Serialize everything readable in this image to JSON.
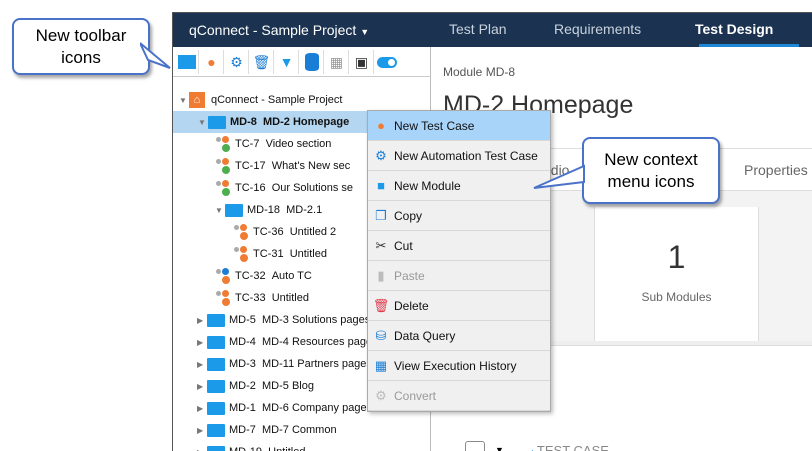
{
  "header": {
    "project": "qConnect - Sample Project",
    "tabs": [
      {
        "label": "Test Plan"
      },
      {
        "label": "Requirements"
      },
      {
        "label": "Test Design",
        "active": true
      }
    ]
  },
  "toolbar": {
    "icons": [
      "new-module-icon",
      "new-test-case-icon",
      "new-automation-test-case-icon",
      "delete-icon",
      "filter-icon",
      "data-query-icon",
      "export-excel-icon",
      "report-icon",
      "toggle-icon"
    ]
  },
  "tree": {
    "root": "qConnect - Sample Project",
    "items": [
      {
        "id": "MD-8",
        "label": "MD-2 Homepage",
        "type": "module",
        "selected": true
      },
      {
        "id": "TC-7",
        "label": "Video section",
        "type": "tc"
      },
      {
        "id": "TC-17",
        "label": "What's New sec",
        "type": "tc"
      },
      {
        "id": "TC-16",
        "label": "Our Solutions se",
        "type": "tc"
      },
      {
        "id": "MD-18",
        "label": "MD-2.1",
        "type": "module"
      },
      {
        "id": "TC-36",
        "label": "Untitled 2",
        "type": "tc2"
      },
      {
        "id": "TC-31",
        "label": "Untitled",
        "type": "tc2"
      },
      {
        "id": "TC-32",
        "label": "Auto TC",
        "type": "auto"
      },
      {
        "id": "TC-33",
        "label": "Untitled",
        "type": "tc2"
      },
      {
        "id": "MD-5",
        "label": "MD-3 Solutions pages",
        "type": "module"
      },
      {
        "id": "MD-4",
        "label": "MD-4 Resources page",
        "type": "module"
      },
      {
        "id": "MD-3",
        "label": "MD-11 Partners pages",
        "type": "module"
      },
      {
        "id": "MD-2",
        "label": "MD-5 Blog",
        "type": "module"
      },
      {
        "id": "MD-1",
        "label": "MD-6 Company page",
        "type": "module"
      },
      {
        "id": "MD-7",
        "label": "MD-7 Common",
        "type": "module"
      },
      {
        "id": "MD-19",
        "label": "Untitled",
        "type": "module"
      }
    ]
  },
  "context_menu": {
    "items": [
      {
        "label": "New Test Case",
        "icon": "new-test-case-icon",
        "highlighted": true
      },
      {
        "label": "New Automation Test Case",
        "icon": "new-automation-test-case-icon"
      },
      {
        "label": "New Module",
        "icon": "new-module-icon"
      },
      {
        "label": "Copy",
        "icon": "copy-icon"
      },
      {
        "label": "Cut",
        "icon": "scissors-icon"
      },
      {
        "label": "Paste",
        "icon": "paste-icon",
        "disabled": true
      },
      {
        "label": "Delete",
        "icon": "trash-icon"
      },
      {
        "label": "Data Query",
        "icon": "database-icon"
      },
      {
        "label": "View Execution History",
        "icon": "calendar-icon"
      },
      {
        "label": "Convert",
        "icon": "convert-icon",
        "disabled": true
      }
    ]
  },
  "detail": {
    "breadcrumb": "Module MD-8",
    "title": "MD-2 Homepage",
    "tab_partial": "udio",
    "tab_properties": "Properties",
    "stat_value": "1",
    "stat_label": "Sub Modules",
    "column_header": "TEST CASE"
  },
  "callouts": {
    "toolbar": "New toolbar icons",
    "menu": "New context menu icons"
  },
  "colors": {
    "header": "#1b3350",
    "accent": "#1e88d6",
    "folder": "#1a9ae8",
    "highlight": "#a9d4fa",
    "callout_border": "#4a72c8"
  }
}
